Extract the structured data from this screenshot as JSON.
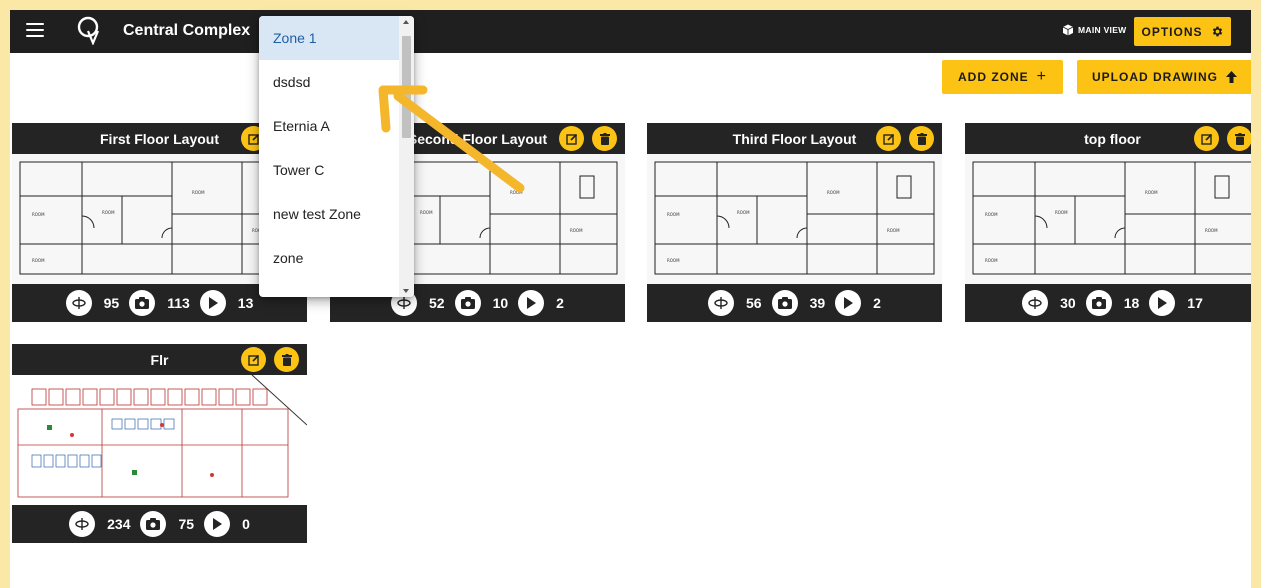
{
  "header": {
    "app_title": "Central Complex",
    "main_view_label": "MAIN VIEW",
    "options_label": "OPTIONS"
  },
  "toolbar": {
    "add_zone_label": "ADD ZONE",
    "upload_drawing_label": "UPLOAD DRAWING"
  },
  "zone_dropdown": {
    "items": [
      "Zone 1",
      "dsdsd",
      "Eternia A",
      "Tower C",
      "new test Zone",
      "zone"
    ],
    "selected": "Zone 1"
  },
  "floors": [
    {
      "title": "First Floor Layout",
      "panoramas": "95",
      "photos": "113",
      "videos": "13"
    },
    {
      "title": "Second Floor Layout",
      "panoramas": "",
      "photos": "52",
      "videos": "10",
      "extra": "2"
    },
    {
      "title": "Third Floor Layout",
      "panoramas": "56",
      "photos": "39",
      "videos": "2"
    },
    {
      "title": "top floor",
      "panoramas": "30",
      "photos": "18",
      "videos": "17"
    },
    {
      "title": "Flr",
      "panoramas": "234",
      "photos": "75",
      "videos": "0"
    }
  ],
  "colors": {
    "accent": "#fcc314",
    "topbar": "#1f1f1f",
    "card": "#242424",
    "frame": "#fbe7a6",
    "selected_bg": "#d9e7f5",
    "selected_text": "#1e5fa8"
  }
}
